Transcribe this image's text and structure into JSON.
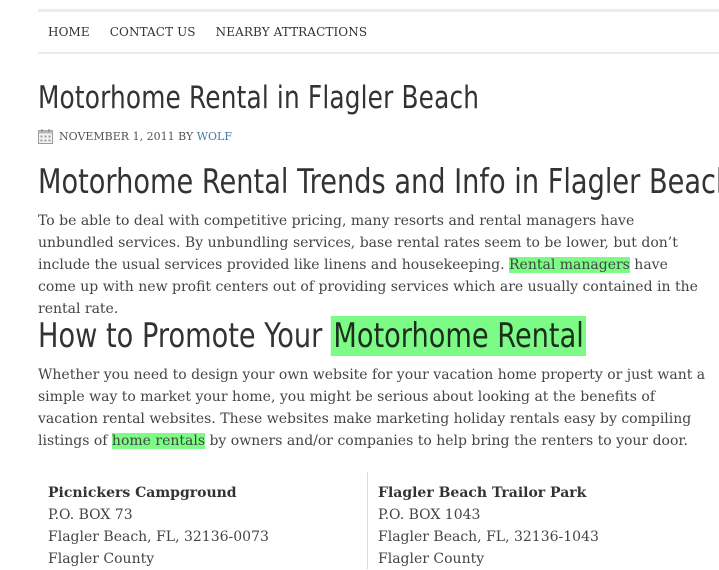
{
  "nav": {
    "items": [
      "HOME",
      "CONTACT US",
      "NEARBY ATTRACTIONS"
    ]
  },
  "post": {
    "title": "Motorhome Rental in Flagler Beach",
    "date": "NOVEMBER 1, 2011",
    "by": "BY",
    "author": "WOLF",
    "calendar_icon": "calendar-icon"
  },
  "section1": {
    "heading": "Motorhome Rental Trends and Info in Flagler Beach",
    "text_before": "To be able to deal with competitive pricing, many resorts and rental managers have unbundled services. By unbundling services, base rental rates seem to be lower, but don’t include the usual services provided like linens and housekeeping. ",
    "highlight": "Rental managers",
    "text_after": " have come up with new profit centers out of providing services which are usually contained in the rental rate."
  },
  "section2": {
    "heading_plain": "How to Promote Your ",
    "heading_highlight": "Motorhome Rental",
    "text_before": "Whether you need to design your own website for your vacation home property or just want a simple way to market your home, you might be serious about looking at the benefits of vacation rental websites. These websites make marketing holiday rentals easy by compiling listings of ",
    "highlight": "home rentals",
    "text_after": " by owners and/or companies to help bring the renters to your door."
  },
  "listings": [
    {
      "name": "Picnickers Campground",
      "box": "P.O. BOX 73",
      "city": "Flagler Beach, FL, 32136-0073",
      "county": "Flagler County"
    },
    {
      "name": "Flagler Beach Trailor Park",
      "box": "P.O. BOX 1043",
      "city": "Flagler Beach, FL, 32136-1043",
      "county": "Flagler County"
    }
  ],
  "colors": {
    "highlight": "#7cfc86",
    "author_link": "#3f7fa0",
    "heading": "#333333",
    "body_text": "#444444"
  }
}
